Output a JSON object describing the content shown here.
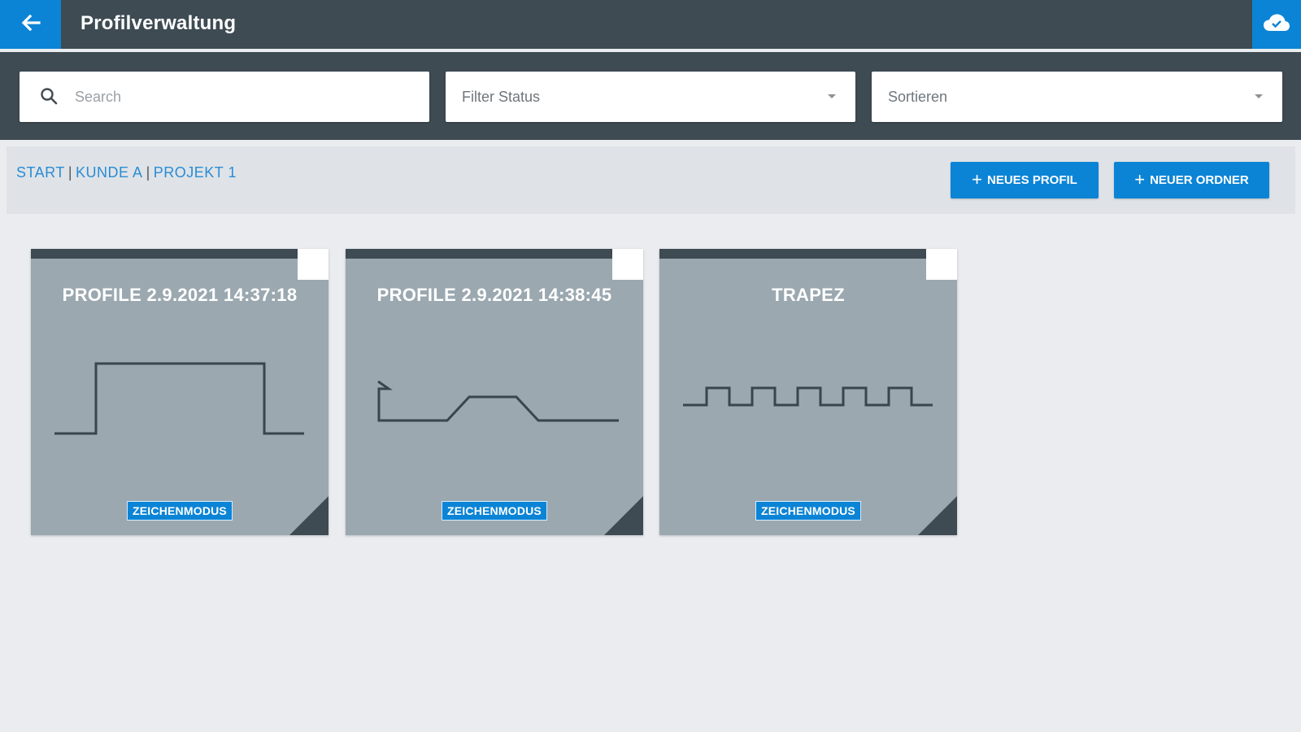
{
  "header": {
    "title": "Profilverwaltung",
    "back_icon": "arrow-left-icon",
    "cloud_icon": "cloud-sync-icon",
    "accent_color": "#0b84d6",
    "bar_color": "#3e4b53"
  },
  "filters": {
    "search_placeholder": "Search",
    "search_value": "",
    "filter_status_label": "Filter Status",
    "sort_label": "Sortieren"
  },
  "breadcrumb": {
    "items": [
      "START",
      "KUNDE A",
      "PROJEKT 1"
    ],
    "separator": "|"
  },
  "actions": {
    "new_profile_label": "NEUES PROFIL",
    "new_folder_label": "NEUER ORDNER",
    "plus": "+"
  },
  "cards": [
    {
      "title": "PROFILE 2.9.2021 14:37:18",
      "badge": "ZEICHENMODUS",
      "graph_icon": "single-pulse-profile-icon"
    },
    {
      "title": "PROFILE 2.9.2021 14:38:45",
      "badge": "ZEICHENMODUS",
      "graph_icon": "ramp-profile-icon"
    },
    {
      "title": "TRAPEZ",
      "badge": "ZEICHENMODUS",
      "graph_icon": "square-wave-profile-icon"
    }
  ]
}
